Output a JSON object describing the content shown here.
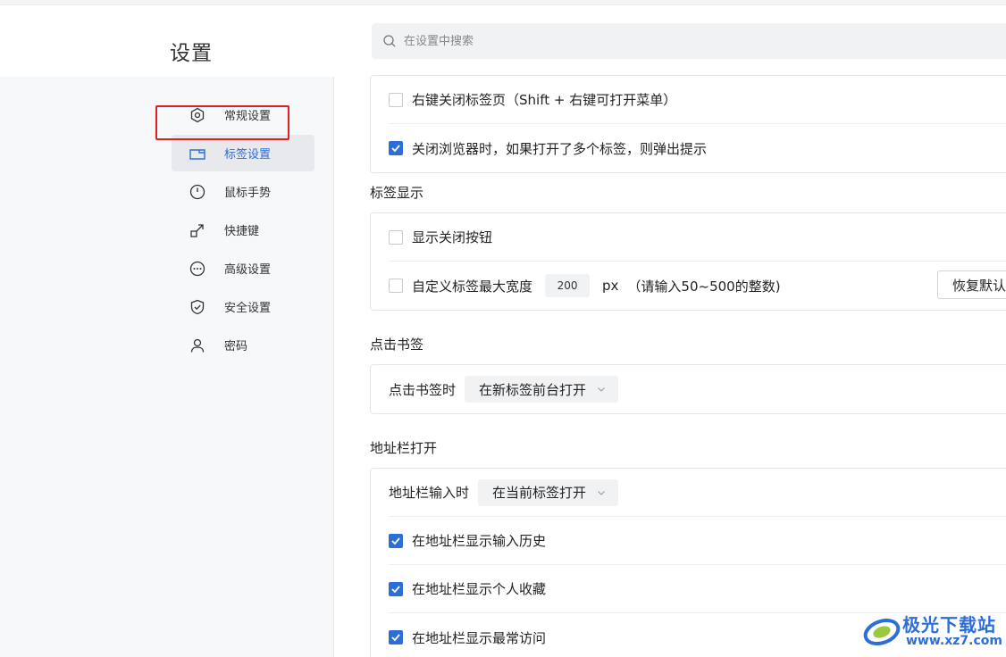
{
  "page": {
    "title": "设置"
  },
  "search": {
    "placeholder": "在设置中搜索"
  },
  "sidebar": {
    "items": [
      {
        "label": "常规设置",
        "icon": "hexagon-gear-icon",
        "active": false,
        "highlighted": true
      },
      {
        "label": "标签设置",
        "icon": "tab-icon",
        "active": true
      },
      {
        "label": "鼠标手势",
        "icon": "mouse-icon",
        "active": false
      },
      {
        "label": "快捷键",
        "icon": "shortcut-arrow-icon",
        "active": false
      },
      {
        "label": "高级设置",
        "icon": "more-circle-icon",
        "active": false
      },
      {
        "label": "安全设置",
        "icon": "shield-icon",
        "active": false
      },
      {
        "label": "密码",
        "icon": "user-icon",
        "active": false
      }
    ]
  },
  "tab_close": {
    "right_click_close": {
      "label": "右键关闭标签页（Shift + 右键可打开菜单）",
      "checked": false
    },
    "warn_on_close": {
      "label": "关闭浏览器时，如果打开了多个标签，则弹出提示",
      "checked": true
    }
  },
  "tab_display": {
    "title": "标签显示",
    "show_close_button": {
      "label": "显示关闭按钮",
      "checked": false
    },
    "max_width": {
      "label": "自定义标签最大宽度",
      "checked": false,
      "value": "200",
      "unit": "px",
      "hint": "（请输入50~500的整数)",
      "reset_label": "恢复默认"
    }
  },
  "bookmark_click": {
    "title": "点击书签",
    "label": "点击书签时",
    "selected": "在新标签前台打开"
  },
  "addressbar_open": {
    "title": "地址栏打开",
    "label": "地址栏输入时",
    "selected": "在当前标签打开",
    "options": [
      {
        "label": "在地址栏显示输入历史",
        "checked": true
      },
      {
        "label": "在地址栏显示个人收藏",
        "checked": true
      },
      {
        "label": "在地址栏显示最常访问",
        "checked": true
      }
    ]
  },
  "watermark": {
    "brand": "极光下载站",
    "url": "www.xz7.com"
  },
  "colors": {
    "accent": "#2c6ed8",
    "highlight_border": "#e02020",
    "sidebar_bg": "#f7f8fa"
  }
}
